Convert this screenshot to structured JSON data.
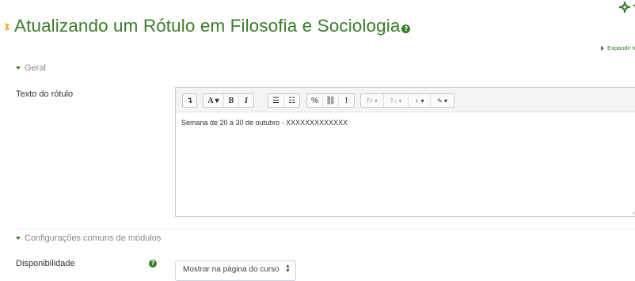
{
  "page": {
    "title": "Atualizando um Rótulo em Filosofia e Sociologia",
    "help_icon": "question-circle-icon",
    "expand_all": "Expandir tudo"
  },
  "general_section": {
    "header": "Geral",
    "label_text_field": "Texto do rótulo"
  },
  "editor": {
    "toolbar": {
      "collapse": "↴",
      "font_color": "A ▾",
      "bold": "B",
      "italic": "I",
      "unordered_list": "☰",
      "ordered_list": "☷",
      "link": "%",
      "unlink": "⛓",
      "emoticon": "!",
      "font_family": "Fr ▾",
      "font_size": "T↕ ▾",
      "insert": "♀ ▾",
      "clear": "✎ ▾"
    },
    "content": "Semana de 20 a 30 de outubro - XXXXXXXXXXXXX"
  },
  "module_section": {
    "header": "Configurações comuns de módulos",
    "availability_label": "Disponibilidade",
    "availability_value": "Mostrar na página do curso"
  },
  "colors": {
    "accent": "#3a7d2c",
    "muted": "#888888"
  }
}
